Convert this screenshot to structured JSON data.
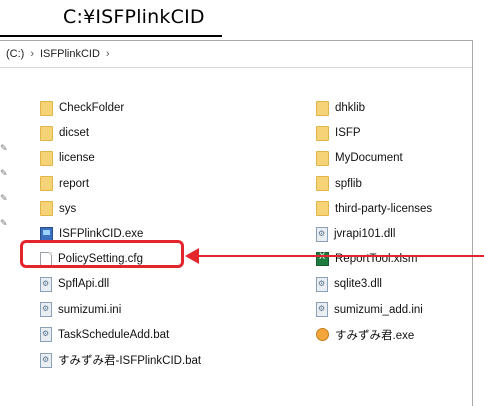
{
  "title": "C:¥ISFPlinkCID",
  "breadcrumb": {
    "drive": "(C:)",
    "sep": "›",
    "folder": "ISFPlinkCID",
    "sep2": "›"
  },
  "left_items": [
    {
      "name": "CheckFolder",
      "type": "folder"
    },
    {
      "name": "dicset",
      "type": "folder"
    },
    {
      "name": "license",
      "type": "folder"
    },
    {
      "name": "report",
      "type": "folder"
    },
    {
      "name": "sys",
      "type": "folder"
    },
    {
      "name": "ISFPlinkCID.exe",
      "type": "exe"
    },
    {
      "name": "PolicySetting.cfg",
      "type": "file"
    },
    {
      "name": "SpflApi.dll",
      "type": "gear"
    },
    {
      "name": "sumizumi.ini",
      "type": "gear"
    },
    {
      "name": "TaskScheduleAdd.bat",
      "type": "gear"
    },
    {
      "name": "すみずみ君-ISFPlinkCID.bat",
      "type": "gear"
    }
  ],
  "right_items": [
    {
      "name": "dhklib",
      "type": "folder"
    },
    {
      "name": "ISFP",
      "type": "folder"
    },
    {
      "name": "MyDocument",
      "type": "folder"
    },
    {
      "name": "spflib",
      "type": "folder"
    },
    {
      "name": "third-party-licenses",
      "type": "folder"
    },
    {
      "name": "jvrapi101.dll",
      "type": "gear"
    },
    {
      "name": "ReportTool.xlsm",
      "type": "excel"
    },
    {
      "name": "sqlite3.dll",
      "type": "gear"
    },
    {
      "name": "sumizumi_add.ini",
      "type": "gear"
    },
    {
      "name": "すみずみ君.exe",
      "type": "orange-exe"
    }
  ],
  "colors": {
    "highlight": "#e3262d",
    "folder": "#f6d376"
  }
}
